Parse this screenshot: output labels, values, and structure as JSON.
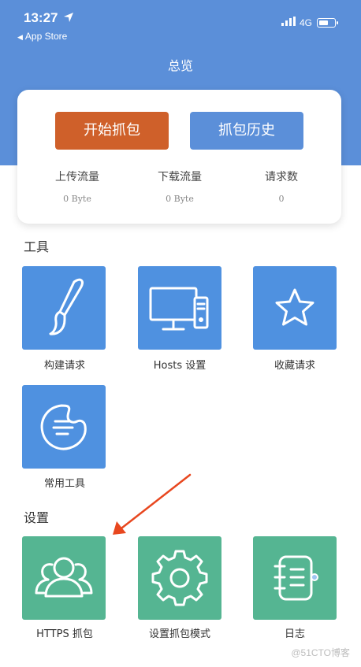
{
  "status_bar": {
    "time": "13:27",
    "back_app": "App Store",
    "network": "4G"
  },
  "nav": {
    "title": "总览"
  },
  "card": {
    "start_button": "开始抓包",
    "history_button": "抓包历史",
    "stats": [
      {
        "label": "上传流量",
        "value": "0 Byte"
      },
      {
        "label": "下载流量",
        "value": "0 Byte"
      },
      {
        "label": "请求数",
        "value": "0"
      }
    ]
  },
  "tools": {
    "title": "工具",
    "items": [
      {
        "label": "构建请求",
        "icon": "brush-icon"
      },
      {
        "label": "Hosts 设置",
        "icon": "computer-icon"
      },
      {
        "label": "收藏请求",
        "icon": "star-icon"
      },
      {
        "label": "常用工具",
        "icon": "palette-icon"
      }
    ]
  },
  "settings": {
    "title": "设置",
    "items": [
      {
        "label": "HTTPS 抓包",
        "icon": "users-icon"
      },
      {
        "label": "设置抓包模式",
        "icon": "gear-icon"
      },
      {
        "label": "日志",
        "icon": "log-book-icon"
      }
    ]
  },
  "watermark": "@51CTO博客",
  "colors": {
    "header": "#5b8fd9",
    "start_button": "#cf602a",
    "tools_tile": "#4f91e0",
    "settings_tile": "#55b592",
    "annotation_arrow": "#e8471f"
  }
}
